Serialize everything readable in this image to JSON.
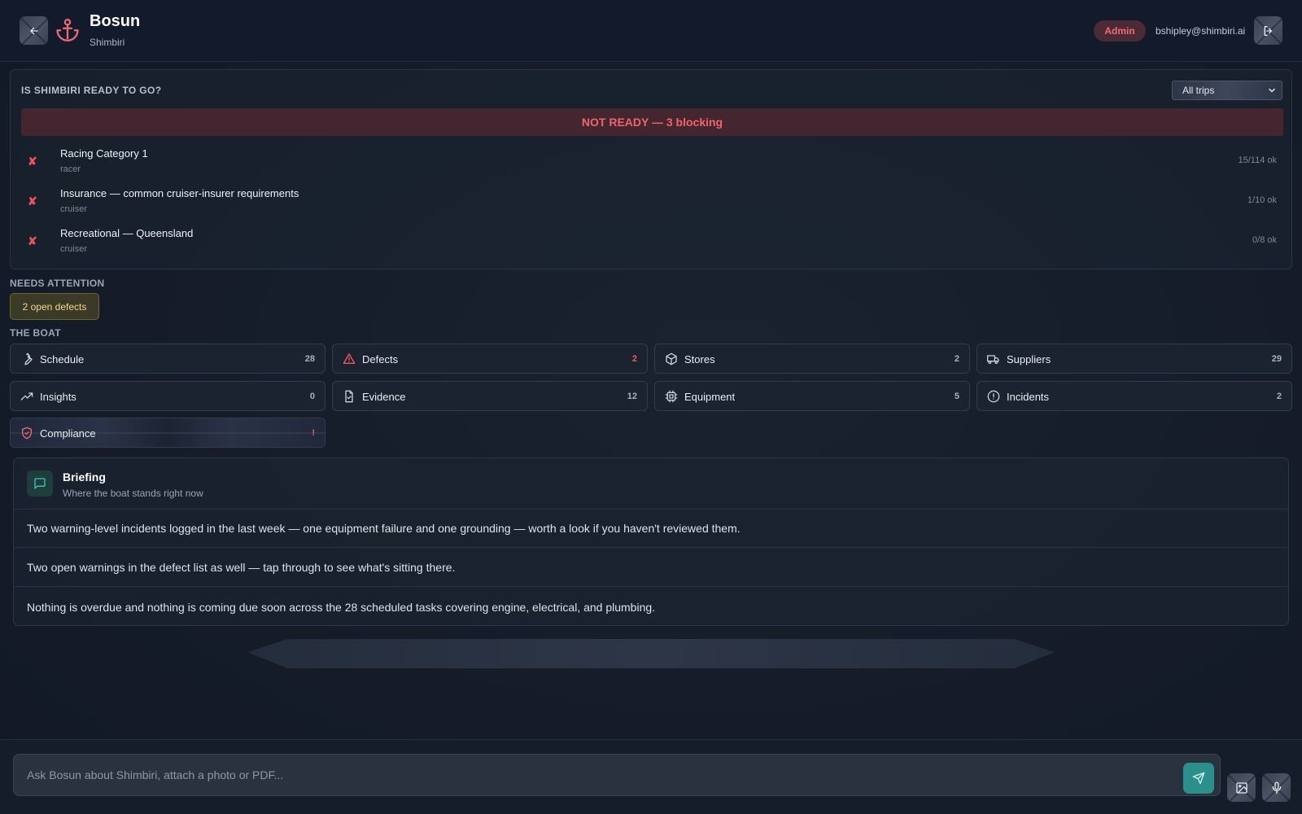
{
  "header": {
    "app_name": "Bosun",
    "boat_name": "Shimbiri",
    "role_badge": "Admin",
    "user_email": "bshipley@shimbiri.ai"
  },
  "readiness": {
    "heading": "IS SHIMBIRI READY TO GO?",
    "trip_filter": "All trips",
    "status": "NOT READY — 3 blocking",
    "checks": [
      {
        "name": "Racing Category 1",
        "tag": "racer",
        "count": "15/114 ok"
      },
      {
        "name": "Insurance — common cruiser-insurer requirements",
        "tag": "cruiser",
        "count": "1/10 ok"
      },
      {
        "name": "Recreational — Queensland",
        "tag": "cruiser",
        "count": "0/8 ok"
      }
    ]
  },
  "attention": {
    "label": "NEEDS ATTENTION",
    "chip": "2 open defects"
  },
  "boat": {
    "label": "THE BOAT",
    "tiles": [
      {
        "label": "Schedule",
        "count": "28"
      },
      {
        "label": "Defects",
        "count": "2"
      },
      {
        "label": "Stores",
        "count": "2"
      },
      {
        "label": "Suppliers",
        "count": "29"
      },
      {
        "label": "Insights",
        "count": "0"
      },
      {
        "label": "Evidence",
        "count": "12"
      },
      {
        "label": "Equipment",
        "count": "5"
      },
      {
        "label": "Incidents",
        "count": "2"
      },
      {
        "label": "Compliance",
        "count": "!"
      }
    ]
  },
  "briefing": {
    "title": "Briefing",
    "subtitle": "Where the boat stands right now",
    "lines": [
      "Two warning-level incidents logged in the last week — one equipment failure and one grounding — worth a look if you haven't reviewed them.",
      "Two open warnings in the defect list as well — tap through to see what's sitting there.",
      "Nothing is overdue and nothing is coming due soon across the 28 scheduled tasks covering engine, electrical, and plumbing."
    ]
  },
  "composer": {
    "placeholder": "Ask Bosun about Shimbiri, attach a photo or PDF..."
  },
  "colors": {
    "accent_teal": "#2b8f8c",
    "danger": "#ef5962",
    "warning": "#f1d98a",
    "background": "#161d29"
  },
  "icons": {
    "back": "arrow-left-icon",
    "logo": "anchor-icon",
    "logout": "logout-icon",
    "send": "send-icon",
    "attach": "image-icon",
    "mic": "microphone-icon"
  }
}
